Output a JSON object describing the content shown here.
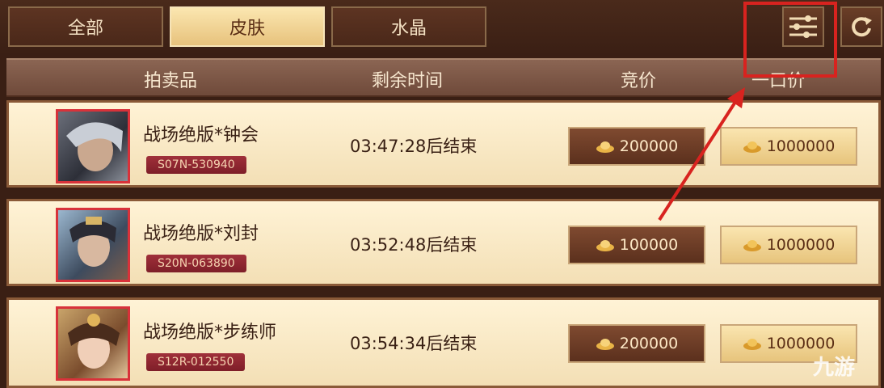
{
  "tabs": [
    {
      "label": "全部"
    },
    {
      "label": "皮肤"
    },
    {
      "label": "水晶"
    }
  ],
  "active_tab": "皮肤",
  "icons": {
    "filter": "filter-sliders-icon",
    "refresh": "refresh-icon",
    "currency": "gold-ingot-icon"
  },
  "columns": {
    "item": "拍卖品",
    "remaining": "剩余时间",
    "bid": "竞价",
    "buyout": "一口价"
  },
  "rows": [
    {
      "name": "战场绝版*钟会",
      "serial": "S07N-530940",
      "time": "03:47:28后结束",
      "bid": "200000",
      "buyout": "1000000"
    },
    {
      "name": "战场绝版*刘封",
      "serial": "S20N-063890",
      "time": "03:52:48后结束",
      "bid": "100000",
      "buyout": "1000000"
    },
    {
      "name": "战场绝版*步练师",
      "serial": "S12R-012550",
      "time": "03:54:34后结束",
      "bid": "200000",
      "buyout": "1000000"
    }
  ],
  "watermark": "九游",
  "colors": {
    "annotation": "#d8231f",
    "bg": "#3a1f14"
  }
}
